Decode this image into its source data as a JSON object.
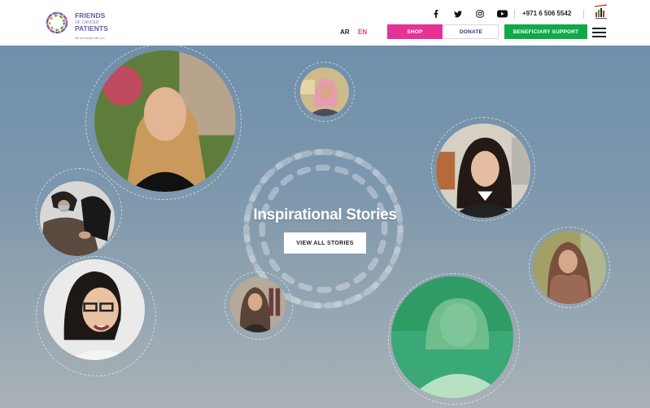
{
  "brand": {
    "line1": "FRIENDS",
    "line2": "OF CANCER",
    "line3": "PATIENTS",
    "tagline": "We are always with you",
    "colors": {
      "purple": "#6d5aa6",
      "pink": "#e53395",
      "green": "#11a84a",
      "navy": "#3a2b86"
    }
  },
  "topbar": {
    "phone": "+971 6 506 5542",
    "social_icons": [
      "facebook-icon",
      "twitter-icon",
      "instagram-icon",
      "youtube-icon"
    ]
  },
  "nav": {
    "lang_ar": "AR",
    "lang_en": "EN",
    "shop": "SHOP",
    "donate": "DONATE",
    "support": "BENEFICIARY SUPPORT"
  },
  "hero": {
    "title": "Inspirational Stories",
    "cta": "VIEW ALL STORIES"
  }
}
